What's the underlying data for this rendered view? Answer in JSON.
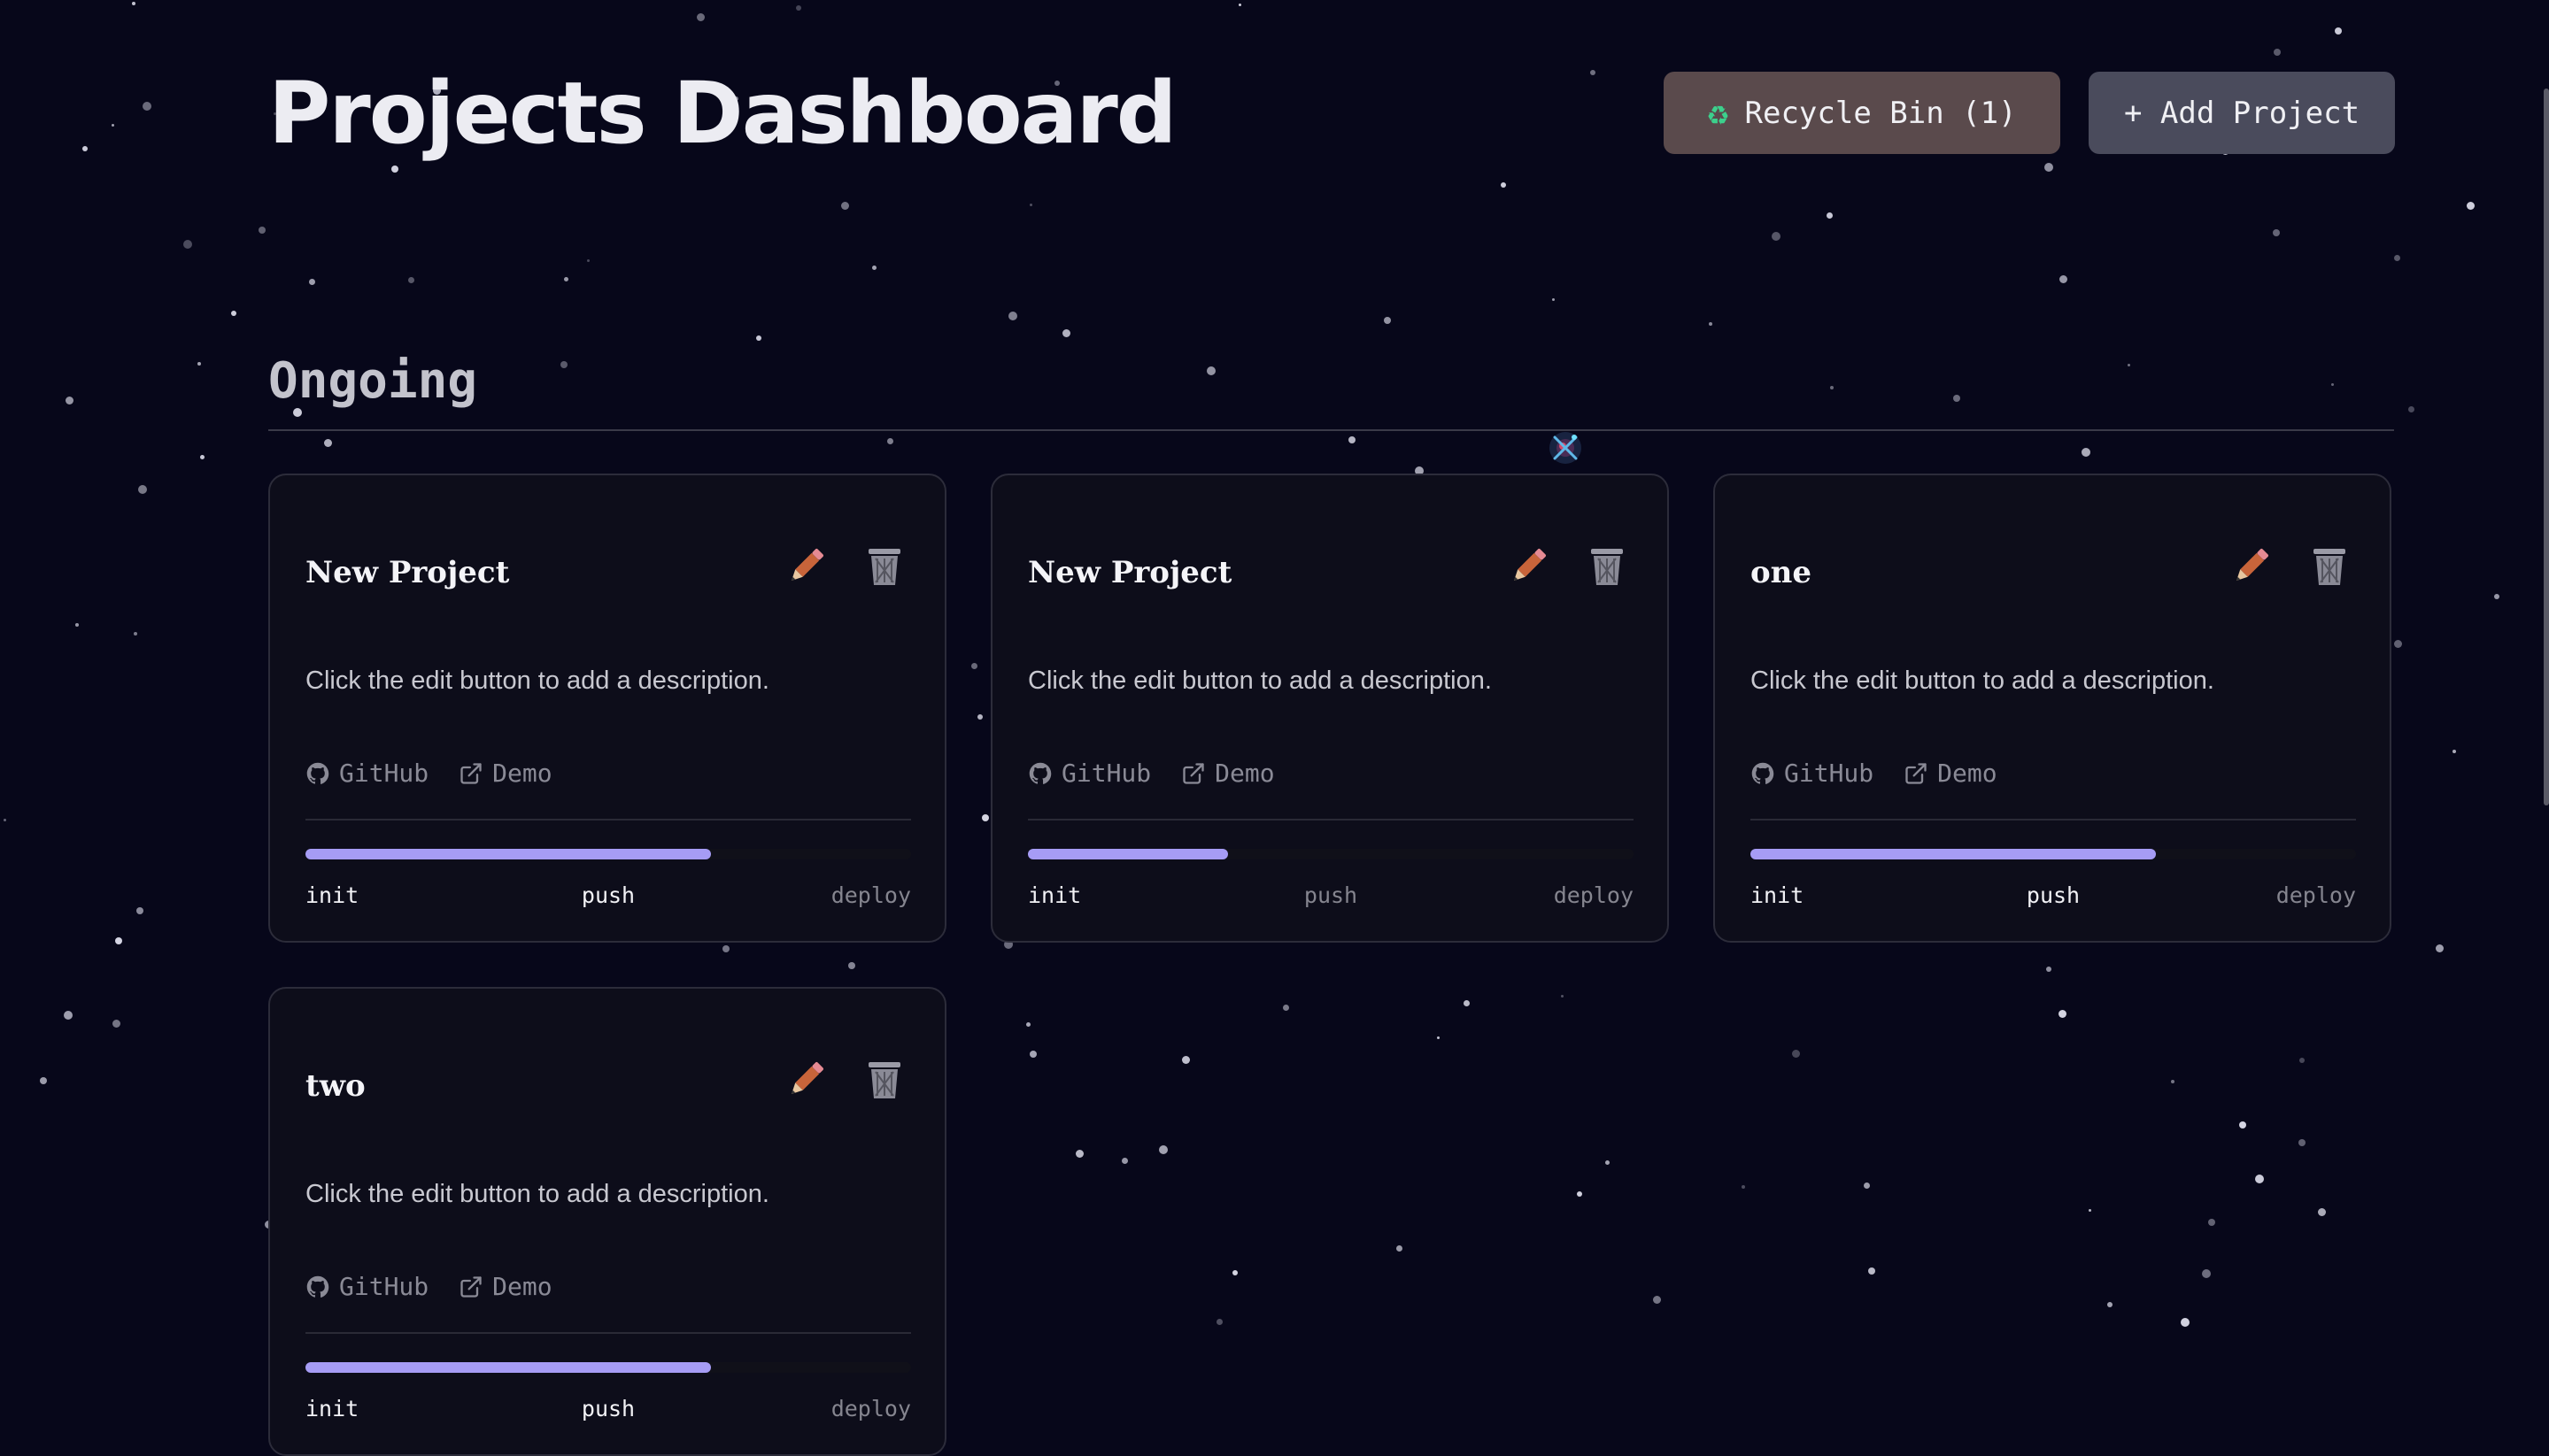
{
  "header": {
    "title": "Projects Dashboard",
    "recycle_bin_label": "Recycle Bin (1)",
    "add_project_label": "+ Add Project"
  },
  "section": {
    "title": "Ongoing"
  },
  "cards": [
    {
      "title": "New Project",
      "description": "Click the edit button to add a description.",
      "github_label": "GitHub",
      "demo_label": "Demo",
      "progress": 0.67,
      "stages": [
        {
          "label": "init",
          "done": true
        },
        {
          "label": "push",
          "done": true
        },
        {
          "label": "deploy",
          "done": false
        }
      ]
    },
    {
      "title": "New Project",
      "description": "Click the edit button to add a description.",
      "github_label": "GitHub",
      "demo_label": "Demo",
      "progress": 0.33,
      "stages": [
        {
          "label": "init",
          "done": true
        },
        {
          "label": "push",
          "done": false
        },
        {
          "label": "deploy",
          "done": false
        }
      ]
    },
    {
      "title": "one",
      "description": "Click the edit button to add a description.",
      "github_label": "GitHub",
      "demo_label": "Demo",
      "progress": 0.67,
      "stages": [
        {
          "label": "init",
          "done": true
        },
        {
          "label": "push",
          "done": true
        },
        {
          "label": "deploy",
          "done": false
        }
      ]
    },
    {
      "title": "two",
      "description": "Click the edit button to add a description.",
      "github_label": "GitHub",
      "demo_label": "Demo",
      "progress": 0.67,
      "stages": [
        {
          "label": "init",
          "done": true
        },
        {
          "label": "push",
          "done": true
        },
        {
          "label": "deploy",
          "done": false
        }
      ]
    }
  ],
  "icons": {
    "recycle": "recycle-icon",
    "edit": "pencil-icon",
    "delete": "trash-icon",
    "github": "github-icon",
    "demo": "external-link-icon"
  },
  "colors": {
    "background": "#07071a",
    "card_background": "#0d0d1a",
    "progress_fill": "#a69cf5",
    "recycle_button": "#5a4a4c",
    "add_button": "#4a4b5c"
  }
}
